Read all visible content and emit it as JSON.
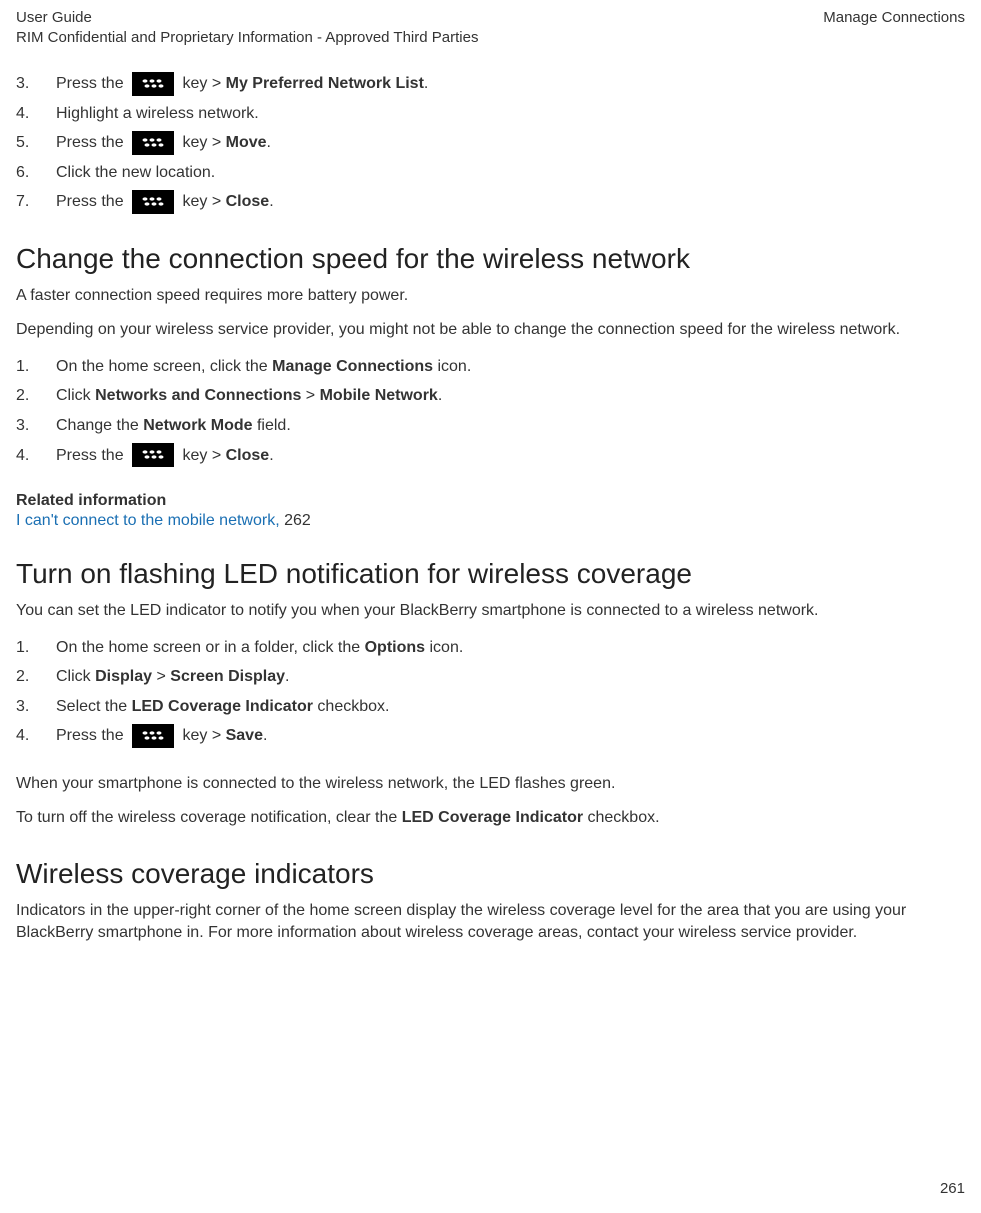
{
  "header": {
    "left_line1": "User Guide",
    "left_line2": "RIM Confidential and Proprietary Information - Approved Third Parties",
    "right": "Manage Connections"
  },
  "list1": {
    "items": [
      {
        "n": "3.",
        "pre": "Press the ",
        "key": true,
        "post": " key > ",
        "bold": "My Preferred Network List",
        "tail": "."
      },
      {
        "n": "4.",
        "pre": "Highlight a wireless network.",
        "key": false,
        "post": "",
        "bold": "",
        "tail": ""
      },
      {
        "n": "5.",
        "pre": "Press the ",
        "key": true,
        "post": " key > ",
        "bold": "Move",
        "tail": "."
      },
      {
        "n": "6.",
        "pre": "Click the new location.",
        "key": false,
        "post": "",
        "bold": "",
        "tail": ""
      },
      {
        "n": "7.",
        "pre": "Press the ",
        "key": true,
        "post": " key > ",
        "bold": "Close",
        "tail": "."
      }
    ]
  },
  "section2": {
    "title": "Change the connection speed for the wireless network",
    "p1": "A faster connection speed requires more battery power.",
    "p2": "Depending on your wireless service provider, you might not be able to change the connection speed for the wireless network.",
    "items": [
      {
        "n": "1.",
        "parts": [
          {
            "t": "On the home screen, click the "
          },
          {
            "t": "Manage Connections",
            "b": true
          },
          {
            "t": " icon."
          }
        ]
      },
      {
        "n": "2.",
        "parts": [
          {
            "t": "Click "
          },
          {
            "t": "Networks and Connections",
            "b": true
          },
          {
            "t": " > "
          },
          {
            "t": "Mobile Network",
            "b": true
          },
          {
            "t": "."
          }
        ]
      },
      {
        "n": "3.",
        "parts": [
          {
            "t": "Change the "
          },
          {
            "t": "Network Mode",
            "b": true
          },
          {
            "t": " field."
          }
        ]
      },
      {
        "n": "4.",
        "key": true,
        "parts_pre": [
          {
            "t": "Press the "
          }
        ],
        "parts_post": [
          {
            "t": " key > "
          },
          {
            "t": "Close",
            "b": true
          },
          {
            "t": "."
          }
        ]
      }
    ],
    "related_head": "Related information",
    "related_link": "I can't connect to the mobile network,",
    "related_page": " 262"
  },
  "section3": {
    "title": "Turn on flashing LED notification for wireless coverage",
    "p1": "You can set the LED indicator to notify you when your BlackBerry smartphone is connected to a wireless network.",
    "items": [
      {
        "n": "1.",
        "parts": [
          {
            "t": "On the home screen or in a folder, click the "
          },
          {
            "t": "Options",
            "b": true
          },
          {
            "t": " icon."
          }
        ]
      },
      {
        "n": "2.",
        "parts": [
          {
            "t": "Click "
          },
          {
            "t": "Display",
            "b": true
          },
          {
            "t": " > "
          },
          {
            "t": "Screen Display",
            "b": true
          },
          {
            "t": "."
          }
        ]
      },
      {
        "n": "3.",
        "parts": [
          {
            "t": "Select the "
          },
          {
            "t": "LED Coverage Indicator",
            "b": true
          },
          {
            "t": " checkbox."
          }
        ]
      },
      {
        "n": "4.",
        "key": true,
        "parts_pre": [
          {
            "t": "Press the "
          }
        ],
        "parts_post": [
          {
            "t": " key > "
          },
          {
            "t": "Save",
            "b": true
          },
          {
            "t": "."
          }
        ]
      }
    ],
    "p2": "When your smartphone is connected to the wireless network, the LED flashes green.",
    "p3_pre": "To turn off the wireless coverage notification, clear the ",
    "p3_bold": "LED Coverage Indicator",
    "p3_post": " checkbox."
  },
  "section4": {
    "title": "Wireless coverage indicators",
    "p1": "Indicators in the upper-right corner of the home screen display the wireless coverage level for the area that you are using your BlackBerry smartphone in. For more information about wireless coverage areas, contact your wireless service provider."
  },
  "footer": {
    "page": "261"
  }
}
